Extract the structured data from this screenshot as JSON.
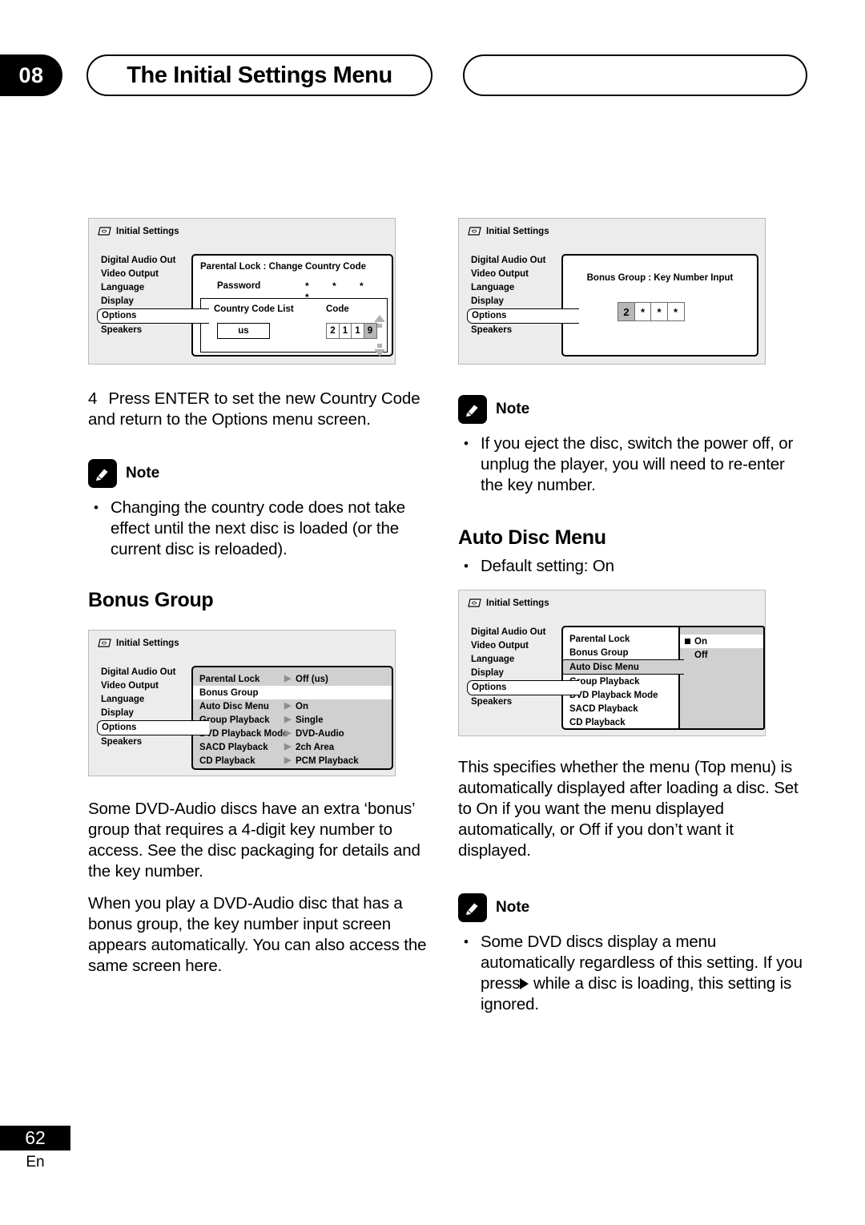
{
  "header": {
    "chapter_number": "08",
    "title": "The Initial Settings Menu",
    "empty_pill": ""
  },
  "osd_common": {
    "title": "Initial Settings",
    "disc_icon": "disc-icon",
    "sidebar": [
      "Digital Audio Out",
      "Video Output",
      "Language",
      "Display",
      "Options",
      "Speakers"
    ],
    "selected_sidebar": "Options"
  },
  "screen1": {
    "panel_title": "Parental Lock : Change Country Code",
    "password_label": "Password",
    "password_value": "* * * *",
    "country_code_list_label": "Country Code List",
    "code_label": "Code",
    "country_code_value": "us",
    "code_digits": [
      "2",
      "1",
      "1",
      "9"
    ],
    "selected_digit_index": 3,
    "up_arrow_icon": "arrow-up-icon",
    "down_arrow_icon": "arrow-down-icon"
  },
  "screen2": {
    "panel_title": "Bonus Group : Key Number Input",
    "key_digits": [
      "2",
      "*",
      "*",
      "*"
    ],
    "selected_digit_index": 0
  },
  "screen3": {
    "rows": [
      {
        "name": "Parental  Lock",
        "value": "Off (us)",
        "has_arrow": true,
        "highlight": false
      },
      {
        "name": "Bonus Group",
        "value": "",
        "has_arrow": false,
        "highlight": true
      },
      {
        "name": "Auto Disc Menu",
        "value": "On",
        "has_arrow": true,
        "highlight": false
      },
      {
        "name": "Group Playback",
        "value": "Single",
        "has_arrow": true,
        "highlight": false
      },
      {
        "name": "DVD Playback Mode",
        "value": "DVD-Audio",
        "has_arrow": true,
        "highlight": false
      },
      {
        "name": "SACD Playback",
        "value": "2ch Area",
        "has_arrow": true,
        "highlight": false
      },
      {
        "name": "CD Playback",
        "value": "PCM Playback",
        "has_arrow": true,
        "highlight": false
      }
    ]
  },
  "screen4": {
    "rows": [
      {
        "name": "Parental  Lock",
        "selected": false
      },
      {
        "name": "Bonus Group",
        "selected": false
      },
      {
        "name": "Auto Disc Menu",
        "selected": true
      },
      {
        "name": "Group Playback",
        "selected": false
      },
      {
        "name": "DVD Playback Mode",
        "selected": false
      },
      {
        "name": "SACD Playback",
        "selected": false
      },
      {
        "name": "CD Playback",
        "selected": false
      }
    ],
    "submenu": [
      {
        "label": "On",
        "current": true
      },
      {
        "label": "Off",
        "current": false
      }
    ]
  },
  "left_column": {
    "step_number": "4",
    "step_text": "Press ENTER to set the new Country Code and return to the Options menu screen.",
    "note_label": "Note",
    "note_bullets": [
      "Changing the country code does not take effect until the next disc is loaded (or the current disc is reloaded)."
    ],
    "heading": "Bonus Group",
    "paragraph1": "Some DVD-Audio discs have an extra ‘bonus’ group that requires a 4-digit key number to access. See the disc packaging for details and the key number.",
    "paragraph2": "When you play a DVD-Audio disc that has a bonus group, the key number input screen appears automatically. You can also access the same screen here."
  },
  "right_column": {
    "note1_label": "Note",
    "note1_bullets": [
      "If you eject the disc, switch the power off, or unplug the player, you will need to re-enter the key number."
    ],
    "heading": "Auto Disc Menu",
    "default_setting": "Default setting: On",
    "paragraph1": "This specifies whether the menu (Top menu) is automatically displayed after loading a disc. Set to On if you want the menu displayed automatically, or Off  if you don’t want it displayed.",
    "note2_label": "Note",
    "note2_bullet_part1": "Some DVD discs display a menu automatically regardless of this setting. If you press",
    "note2_bullet_part2": "while a disc is loading, this setting is ignored."
  },
  "footer": {
    "page_number": "62",
    "language": "En"
  }
}
